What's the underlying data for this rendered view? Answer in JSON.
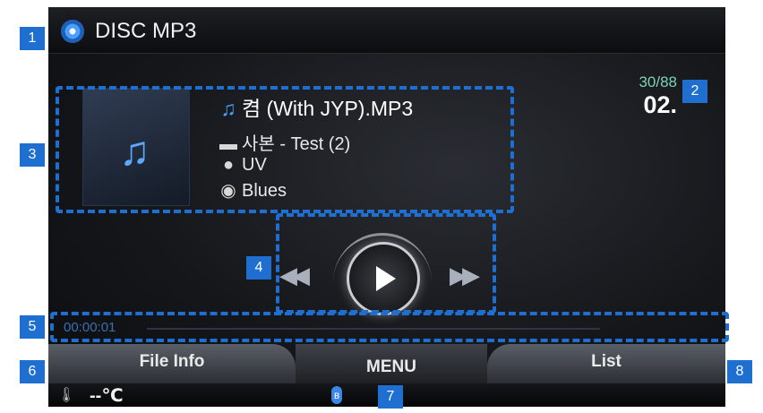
{
  "header": {
    "title": "DISC MP3",
    "icon": "disc-icon"
  },
  "track": {
    "title": "켬 (With JYP).MP3",
    "folder": "사본 - Test (2)",
    "artist": "UV",
    "genre": "Blues",
    "counter_total": "30/88",
    "counter_track": "02."
  },
  "icons": {
    "title": "♫",
    "folder": "▬",
    "artist": "●",
    "genre": "◉",
    "album": "♫",
    "thermometer": "🌡",
    "bluetooth": "ʙ"
  },
  "controls": {
    "prev": "◀◀",
    "next": "▶▶"
  },
  "progress": {
    "time": "00:00:01"
  },
  "softkeys": {
    "left": "File Info",
    "middle": "MENU",
    "right": "List"
  },
  "status": {
    "temperature": "--℃"
  },
  "callouts": [
    "1",
    "2",
    "3",
    "4",
    "5",
    "6",
    "7",
    "8"
  ],
  "colors": {
    "callout_blue": "#1f6fd1",
    "accent_blue": "#4aa0ff",
    "counter_green": "#7fd1b2"
  }
}
